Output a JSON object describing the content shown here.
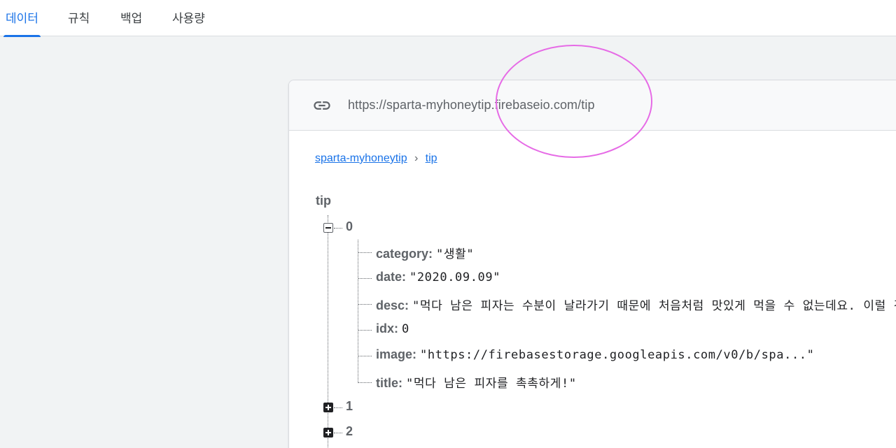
{
  "tabs": [
    {
      "label": "데이터",
      "active": true
    },
    {
      "label": "규칙",
      "active": false
    },
    {
      "label": "백업",
      "active": false
    },
    {
      "label": "사용량",
      "active": false
    }
  ],
  "url_bar": {
    "icon": "link-icon",
    "url": "https://sparta-myhoneytip.firebaseio.com/tip"
  },
  "breadcrumb": {
    "items": [
      "sparta-myhoneytip",
      "tip"
    ],
    "separator": "›"
  },
  "tree": {
    "root": "tip",
    "nodes": [
      {
        "key": "0",
        "expanded": true,
        "children": [
          {
            "key": "category",
            "value": "\"생활\""
          },
          {
            "key": "date",
            "value": "\"2020.09.09\""
          },
          {
            "key": "desc",
            "value": "\"먹다 남은 피자는 수분이 날라가기 때문에 처음처럼 맛있게 먹을 수 없는데요. 이럴 경"
          },
          {
            "key": "idx",
            "value": "0"
          },
          {
            "key": "image",
            "value": "\"https://firebasestorage.googleapis.com/v0/b/spa...\""
          },
          {
            "key": "title",
            "value": "\"먹다 남은 피자를 촉촉하게!\""
          }
        ]
      },
      {
        "key": "1",
        "expanded": false
      },
      {
        "key": "2",
        "expanded": false
      }
    ]
  },
  "colors": {
    "accent": "#1a73e8",
    "annotation": "#e66be6",
    "background": "#f1f3f4"
  }
}
